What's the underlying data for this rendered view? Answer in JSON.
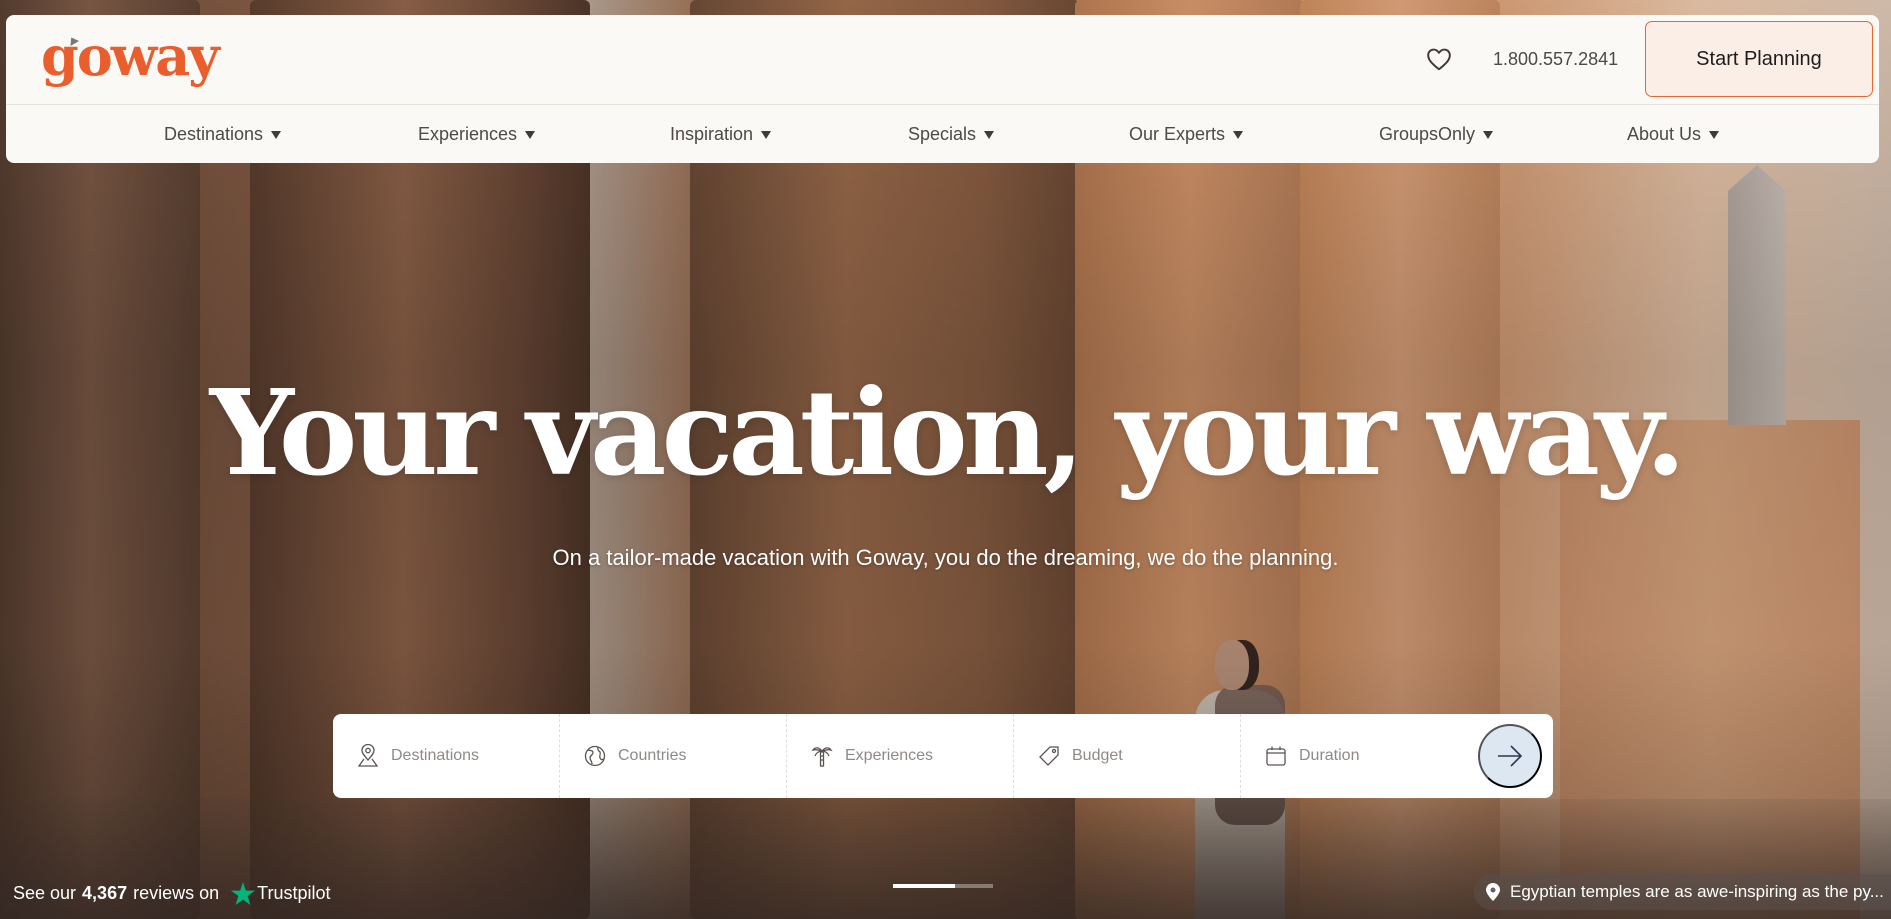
{
  "brand": {
    "name": "goway",
    "accent_color": "#ea5d2c"
  },
  "header": {
    "favorites_icon": "heart-icon",
    "phone": "1.800.557.2841",
    "cta_label": "Start Planning"
  },
  "nav": {
    "items": [
      {
        "label": "Destinations"
      },
      {
        "label": "Experiences"
      },
      {
        "label": "Inspiration"
      },
      {
        "label": "Specials"
      },
      {
        "label": "Our Experts"
      },
      {
        "label": "GroupsOnly"
      },
      {
        "label": "About Us"
      }
    ]
  },
  "hero": {
    "headline": "Your vacation, your way.",
    "subtitle": "On a tailor-made vacation with Goway, you do the dreaming, we do the planning."
  },
  "search": {
    "fields": [
      {
        "label": "Destinations",
        "icon": "map-pin-icon"
      },
      {
        "label": "Countries",
        "icon": "globe-icon"
      },
      {
        "label": "Experiences",
        "icon": "palm-tree-icon"
      },
      {
        "label": "Budget",
        "icon": "price-tag-icon"
      },
      {
        "label": "Duration",
        "icon": "calendar-icon"
      }
    ],
    "submit_icon": "arrow-right-icon",
    "submit_color": "#dce7f1"
  },
  "reviews": {
    "prefix": "See our",
    "count": "4,367",
    "suffix": "reviews on",
    "brand": "Trustpilot",
    "brand_color": "#00b67a"
  },
  "carousel": {
    "progress": 0.62
  },
  "caption": {
    "icon": "location-pin-icon",
    "text": "Egyptian temples are as awe-inspiring as the py..."
  }
}
